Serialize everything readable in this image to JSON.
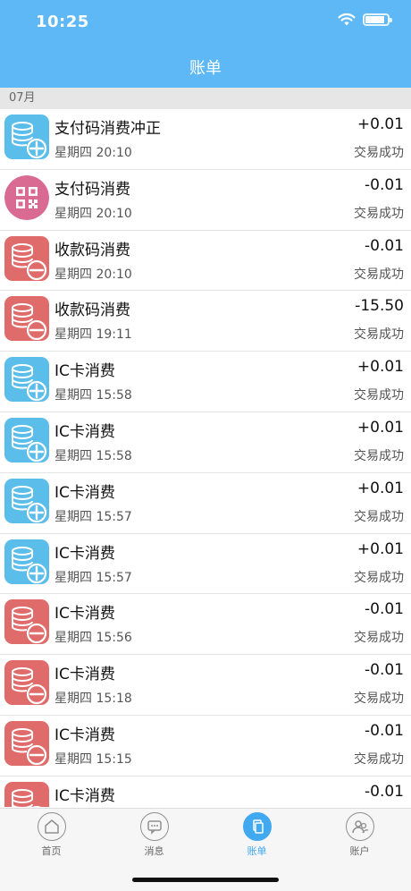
{
  "status_bar": {
    "time": "10:25"
  },
  "header": {
    "title": "账单"
  },
  "section": {
    "label": "07月"
  },
  "colors": {
    "header_bg": "#5db8f5",
    "income_icon": "#5bbde9",
    "expense_icon": "#e06b6b",
    "qr_icon": "#d96a92",
    "tab_active": "#40a9ef"
  },
  "transactions": [
    {
      "icon": "coins-plus-icon",
      "type": "income",
      "title": "支付码消费冲正",
      "time": "星期四 20:10",
      "amount": "+0.01",
      "status": "交易成功"
    },
    {
      "icon": "qr-code-icon",
      "type": "qr",
      "title": "支付码消费",
      "time": "星期四 20:10",
      "amount": "-0.01",
      "status": "交易成功"
    },
    {
      "icon": "coins-minus-icon",
      "type": "expense",
      "title": "收款码消费",
      "time": "星期四 20:10",
      "amount": "-0.01",
      "status": "交易成功"
    },
    {
      "icon": "coins-minus-icon",
      "type": "expense",
      "title": "收款码消费",
      "time": "星期四 19:11",
      "amount": "-15.50",
      "status": "交易成功"
    },
    {
      "icon": "coins-plus-icon",
      "type": "income",
      "title": "IC卡消费",
      "time": "星期四 15:58",
      "amount": "+0.01",
      "status": "交易成功"
    },
    {
      "icon": "coins-plus-icon",
      "type": "income",
      "title": "IC卡消费",
      "time": "星期四 15:58",
      "amount": "+0.01",
      "status": "交易成功"
    },
    {
      "icon": "coins-plus-icon",
      "type": "income",
      "title": "IC卡消费",
      "time": "星期四 15:57",
      "amount": "+0.01",
      "status": "交易成功"
    },
    {
      "icon": "coins-plus-icon",
      "type": "income",
      "title": "IC卡消费",
      "time": "星期四 15:57",
      "amount": "+0.01",
      "status": "交易成功"
    },
    {
      "icon": "coins-minus-icon",
      "type": "expense",
      "title": "IC卡消费",
      "time": "星期四 15:56",
      "amount": "-0.01",
      "status": "交易成功"
    },
    {
      "icon": "coins-minus-icon",
      "type": "expense",
      "title": "IC卡消费",
      "time": "星期四 15:18",
      "amount": "-0.01",
      "status": "交易成功"
    },
    {
      "icon": "coins-minus-icon",
      "type": "expense",
      "title": "IC卡消费",
      "time": "星期四 15:15",
      "amount": "-0.01",
      "status": "交易成功"
    },
    {
      "icon": "coins-minus-icon",
      "type": "expense",
      "title": "IC卡消费",
      "time": "",
      "amount": "-0.01",
      "status": ""
    }
  ],
  "tabbar": {
    "tabs": [
      {
        "label": "首页",
        "icon": "home-icon",
        "active": false
      },
      {
        "label": "消息",
        "icon": "message-icon",
        "active": false
      },
      {
        "label": "账单",
        "icon": "bill-icon",
        "active": true
      },
      {
        "label": "账户",
        "icon": "account-icon",
        "active": false
      }
    ]
  }
}
